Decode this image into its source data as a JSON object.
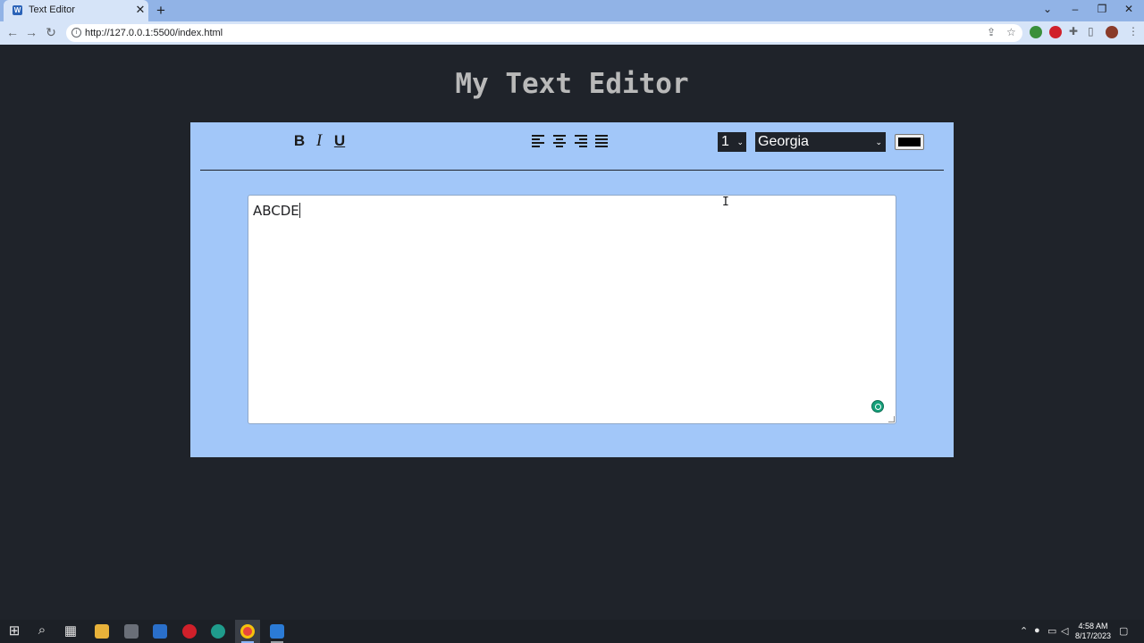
{
  "browser": {
    "tab_title": "Text Editor",
    "tab_close": "✕",
    "new_tab": "+",
    "url": "http://127.0.0.1:5500/index.html",
    "back": "←",
    "forward": "→",
    "reload": "↻",
    "window_controls": {
      "chevron": "⌄",
      "minimize": "–",
      "restore": "❐",
      "close": "✕"
    }
  },
  "page": {
    "title": "My Text Editor"
  },
  "toolbar": {
    "bold_label": "B",
    "italic_label": "I",
    "underline_label": "U",
    "font_size_value": "1",
    "font_family_value": "Georgia",
    "color_value": "#000000",
    "chevron": "⌄"
  },
  "editor": {
    "text": "ABCDE"
  },
  "taskbar": {
    "clock_time": "4:58 AM",
    "clock_date": "8/17/2023"
  },
  "colors": {
    "page_bg": "#1f232a",
    "editor_bg": "#a2c7f9",
    "title": "#b9b9b9",
    "select_bg": "#1f232a"
  }
}
